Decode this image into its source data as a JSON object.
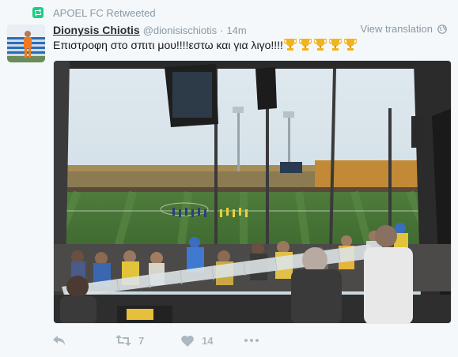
{
  "retweet_context": {
    "text": "APOEL FC Retweeted",
    "icon": "retweet-icon"
  },
  "author": {
    "fullname": "Dionysis Chiotis",
    "username": "@dionisischiotis",
    "separator": "·",
    "timestamp": "14m"
  },
  "translate_label": "View translation",
  "tweet": {
    "text": "Επιστροφη στο σπιτι μου!!!!εστω και για λιγο!!!!",
    "emoji": [
      "trophy",
      "trophy",
      "trophy",
      "trophy",
      "trophy"
    ]
  },
  "media": {
    "description_icon": "stadium-photo"
  },
  "actions": {
    "reply_icon": "reply-icon",
    "retweet_count": "7",
    "like_count": "14",
    "more_icon": "more-icon"
  },
  "colors": {
    "retweet_green": "#19cf86",
    "muted": "#8899a6",
    "action_gray": "#aab8c2",
    "background": "#f5f8fa"
  }
}
